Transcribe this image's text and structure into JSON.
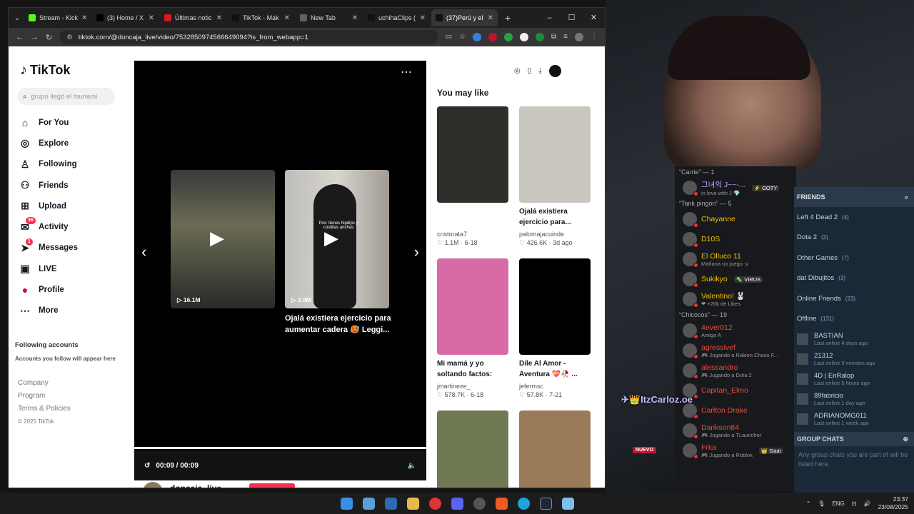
{
  "browser": {
    "tabs": [
      {
        "label": "Stream - Kick",
        "color": "#53fc18",
        "active": false
      },
      {
        "label": "(3) Home / X",
        "color": "#000000",
        "active": false
      },
      {
        "label": "Últimas notic",
        "color": "#d71920",
        "active": false
      },
      {
        "label": "TikTok - Mak",
        "color": "#111111",
        "active": false
      },
      {
        "label": "New Tab",
        "color": "#5f6368",
        "active": false
      },
      {
        "label": "uchihaClips (",
        "color": "#111111",
        "active": false
      },
      {
        "label": "(37)Perú y el",
        "color": "#111111",
        "active": true
      }
    ],
    "new_tab": "+",
    "url": "tiktok.com/@doncaja_live/video/7532850974566649094?is_from_webapp=1"
  },
  "tiktok": {
    "logo": "TikTok",
    "search_placeholder": "grupo llegó el tsunami",
    "nav": [
      {
        "label": "For You",
        "icon": "home-icon",
        "glyph": "⌂"
      },
      {
        "label": "Explore",
        "icon": "compass-icon",
        "glyph": "◎"
      },
      {
        "label": "Following",
        "icon": "following-icon",
        "glyph": "♙"
      },
      {
        "label": "Friends",
        "icon": "friends-icon",
        "glyph": "⚇"
      },
      {
        "label": "Upload",
        "icon": "upload-icon",
        "glyph": "⊞"
      },
      {
        "label": "Activity",
        "icon": "activity-icon",
        "glyph": "✉",
        "badge": "36"
      },
      {
        "label": "Messages",
        "icon": "messages-icon",
        "glyph": "➤",
        "badge": "1"
      },
      {
        "label": "LIVE",
        "icon": "live-icon",
        "glyph": "▣"
      },
      {
        "label": "Profile",
        "icon": "profile-icon",
        "glyph": "●"
      },
      {
        "label": "More",
        "icon": "more-icon",
        "glyph": "⋯"
      }
    ],
    "following_title": "Following accounts",
    "following_sub": "Accounts you follow will appear here",
    "footer": {
      "company": "Company",
      "program": "Program",
      "terms": "Terms & Policies",
      "copyright": "© 2025 TikTok"
    },
    "player": {
      "thumb1_views": "16.1M",
      "thumb2_views": "3.9M",
      "thumb2_overlay": "Pov: tienes hipdips y costillas anchas",
      "caption": "Ojalá existiera ejercicio para aumentar cadera 🥵 Leggi...",
      "time": "00:09 / 00:09",
      "progress": 1.0
    },
    "author": "doncaja_live",
    "you_may_like": "You may like",
    "cards": [
      {
        "title": "",
        "author": "cristorata7",
        "likes": "1.1M",
        "date": "6-18",
        "bg": "#2e2e2a"
      },
      {
        "title": "Ojalá existiera ejercicio para...",
        "author": "palomajacuinde",
        "likes": "426.6K",
        "date": "3d ago",
        "bg": "#c9c6c0"
      },
      {
        "title": "Mi mamá y yo soltando factos:",
        "author": "jmartineze_",
        "likes": "578.7K",
        "date": "6-18",
        "bg": "#d96aa8"
      },
      {
        "title": "Dile Al Amor - Aventura 💝🥀 ...",
        "author": "jefermsc",
        "likes": "57.8K",
        "date": "7-21",
        "bg": "#000000"
      },
      {
        "title": "",
        "author": "",
        "likes": "",
        "date": "",
        "bg": "#6f7a55"
      },
      {
        "title": "",
        "author": "",
        "likes": "",
        "date": "",
        "bg": "#9b7a5a"
      }
    ]
  },
  "discord": {
    "groups": [
      {
        "title": "“Carrie” — 1",
        "members": [
          {
            "name": "그녀의 J~~-...",
            "status": "in love with J 💎",
            "color": "#b9a3ff",
            "tag": "⚡ GOTY"
          }
        ]
      },
      {
        "title": "“Tank pingon” — 5",
        "members": [
          {
            "name": "Chayanne",
            "status": "",
            "color": "#f0c000",
            "tag": ""
          },
          {
            "name": "D10S",
            "status": "",
            "color": "#f0c000",
            "tag": ""
          },
          {
            "name": "El Olluco 11",
            "status": "Mañana no juego :v",
            "color": "#f0c000",
            "tag": ""
          },
          {
            "name": "Sukikyo",
            "status": "",
            "color": "#f0c000",
            "tag": "🦠 VIRUS"
          },
          {
            "name": "Valentino! 🐰",
            "status": "❤ +20k de Likes",
            "color": "#f0c000",
            "tag": ""
          }
        ]
      },
      {
        "title": "“Chicocos” — 19",
        "members": [
          {
            "name": "4ever012",
            "status": "Amigo A",
            "color": "#e74c3c",
            "tag": ""
          },
          {
            "name": "agressivef",
            "status": "🎮 Jugando a Rakion Chaos F...",
            "color": "#e74c3c",
            "tag": ""
          },
          {
            "name": "alessandro",
            "status": "🎮 Jugando a Dota 2",
            "color": "#e74c3c",
            "tag": ""
          },
          {
            "name": "Capitan_Elmo",
            "status": "",
            "color": "#e74c3c",
            "tag": ""
          },
          {
            "name": "Carlton Drake",
            "status": "",
            "color": "#e74c3c",
            "tag": ""
          },
          {
            "name": "Darikson84",
            "status": "🎮 Jugando a TLauncher",
            "color": "#e74c3c",
            "tag": ""
          },
          {
            "name": "Frka",
            "status": "🎮 Jugando a Roblox",
            "color": "#e74c3c",
            "tag": "👑 Gaat"
          }
        ]
      }
    ]
  },
  "steam": {
    "header": "FRIENDS",
    "groups": [
      {
        "label": "Left 4 Dead 2",
        "count": "(4)"
      },
      {
        "label": "Dota 2",
        "count": "(2)"
      },
      {
        "label": "Other Games",
        "count": "(7)"
      },
      {
        "label": "dat Dibujitos",
        "count": "(3)"
      },
      {
        "label": "Online Friends",
        "count": "(23)"
      },
      {
        "label": "Offline",
        "count": "(131)"
      }
    ],
    "offline": [
      {
        "name": "BASTIAN",
        "status": "Last online 4 days ago"
      },
      {
        "name": "21312",
        "status": "Last online 9 minutes ago"
      },
      {
        "name": "4D | EnRalop",
        "status": "Last online 5 hours ago"
      },
      {
        "name": "89fabricio",
        "status": "Last online 1 day ago"
      },
      {
        "name": "ADRIANOMG011",
        "status": "Last online 1 week ago"
      }
    ],
    "group_chats": "GROUP CHATS",
    "group_chats_msg": "Any group chats you are part of will be listed here."
  },
  "overlay": {
    "name": "✈👑ItzCarloz.oe",
    "nuevo": "NUEVO"
  },
  "taskbar": {
    "lang": "ENG",
    "time": "23:37",
    "date": "23/08/2025"
  }
}
